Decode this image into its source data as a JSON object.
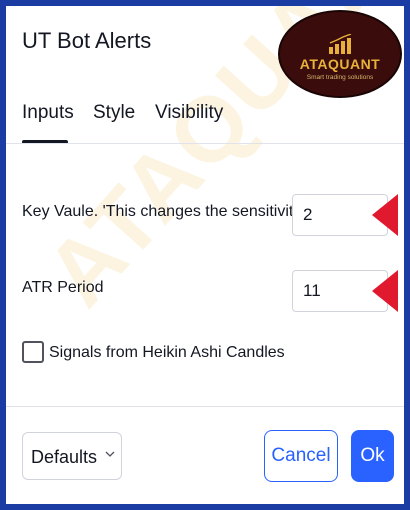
{
  "dialog": {
    "title": "UT Bot Alerts"
  },
  "logo": {
    "name": "ATAQUANT",
    "tagline": "Smart trading solutions",
    "watermark": "ATAQUANT"
  },
  "tabs": [
    {
      "label": "Inputs",
      "active": true
    },
    {
      "label": "Style",
      "active": false
    },
    {
      "label": "Visibility",
      "active": false
    }
  ],
  "inputs": {
    "key_value": {
      "label": "Key Vaule. 'This changes the sensitivity'",
      "value": "2"
    },
    "atr_period": {
      "label": "ATR Period",
      "value": "11"
    },
    "heikin_ashi": {
      "label": "Signals from Heikin Ashi Candles",
      "checked": false
    }
  },
  "footer": {
    "defaults_label": "Defaults",
    "cancel_label": "Cancel",
    "ok_label": "Ok"
  },
  "colors": {
    "accent": "#2962ff",
    "frame": "#1b3da3",
    "marker": "#e0192f",
    "logo_bg": "#3b0c0c",
    "logo_gold": "#e8b23a"
  }
}
